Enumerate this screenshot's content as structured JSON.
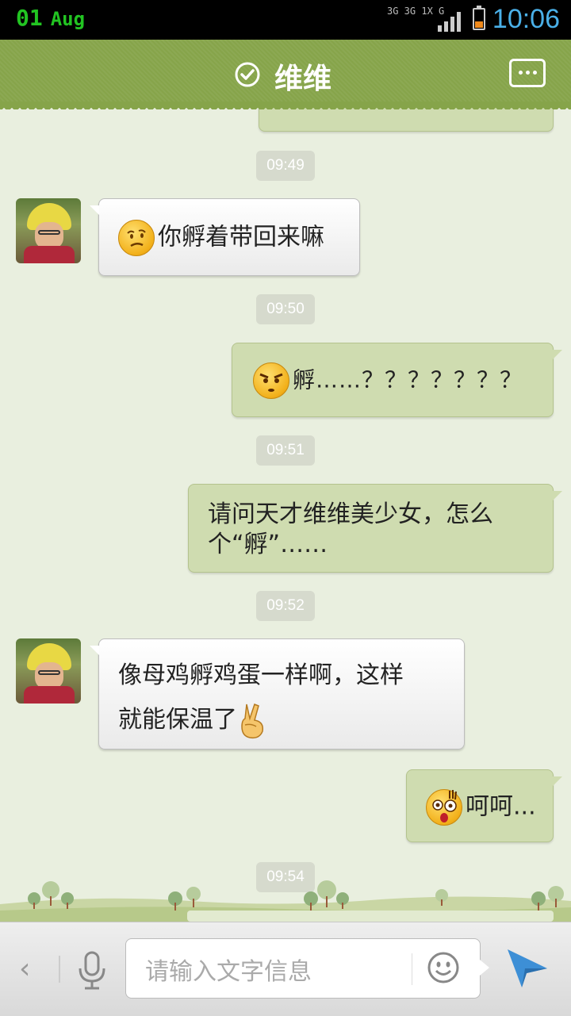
{
  "status_bar": {
    "date_day": "01",
    "date_month": "Aug",
    "network_top": "3G 3G 1X G",
    "time": "10:06"
  },
  "header": {
    "contact_name": "维维",
    "verified_icon": "check-circle-icon",
    "more_icon": "more-dots-icon"
  },
  "messages": [
    {
      "type": "timestamp",
      "text": "09:49"
    },
    {
      "type": "incoming",
      "emoji": "confused-face-icon",
      "text": "你孵着带回来嘛"
    },
    {
      "type": "timestamp",
      "text": "09:50"
    },
    {
      "type": "outgoing",
      "emoji": "angry-face-icon",
      "text": "孵……？？？？？？？"
    },
    {
      "type": "timestamp",
      "text": "09:51"
    },
    {
      "type": "outgoing",
      "text_line1": "请问天才维维美少女，怎么",
      "text_line2": "个“孵”……"
    },
    {
      "type": "timestamp",
      "text": "09:52"
    },
    {
      "type": "incoming",
      "text_line1": "像母鸡孵鸡蛋一样啊，这样",
      "text_line2": "就能保温了",
      "emoji": "victory-hand-icon"
    },
    {
      "type": "outgoing",
      "emoji": "shocked-face-icon",
      "text": "呵呵..."
    },
    {
      "type": "timestamp",
      "text": "09:54"
    }
  ],
  "input_bar": {
    "placeholder": "请输入文字信息",
    "back_icon": "chevron-left-icon",
    "voice_icon": "microphone-icon",
    "emoji_icon": "smiley-icon",
    "send_icon": "send-arrow-icon"
  },
  "colors": {
    "header": "#86a44a",
    "background": "#e9efdf",
    "outgoing_bubble": "#cfdcb0",
    "incoming_bubble": "#ffffff",
    "time": "#4ab0e8"
  }
}
